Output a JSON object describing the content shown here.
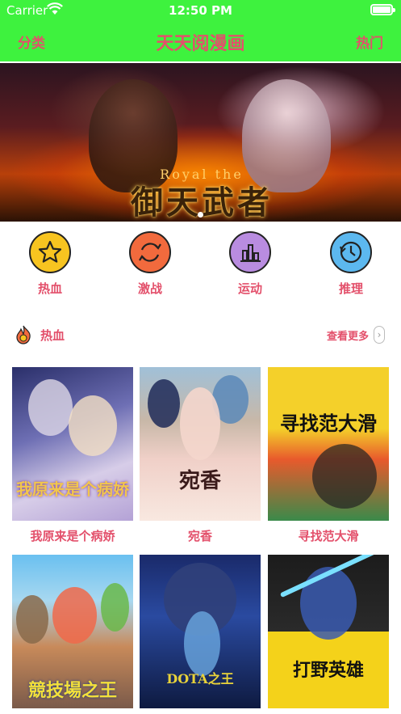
{
  "status": {
    "carrier": "Carrier",
    "time": "12:50 PM"
  },
  "nav": {
    "left": "分类",
    "title": "天天阅漫画",
    "right": "热门"
  },
  "banner": {
    "title_art": "御天武者",
    "title_art_en": "Royal the"
  },
  "categories": [
    {
      "label": "热血",
      "icon": "star-icon",
      "color": "#f7c420"
    },
    {
      "label": "激战",
      "icon": "refresh-icon",
      "color": "#f26a3d"
    },
    {
      "label": "运动",
      "icon": "bar-chart-icon",
      "color": "#b98ce0"
    },
    {
      "label": "推理",
      "icon": "clock-icon",
      "color": "#5cb8ef"
    }
  ],
  "section": {
    "title": "热血",
    "more": "查看更多",
    "arrow": "›"
  },
  "comics": [
    {
      "name": "我原来是个病娇",
      "cover_text": "我原来是个病娇"
    },
    {
      "name": "宛香",
      "cover_text": "宛香"
    },
    {
      "name": "寻找范大滑",
      "cover_text": "寻找范大滑"
    },
    {
      "name": "",
      "cover_text": "競技場之王"
    },
    {
      "name": "",
      "cover_text": "DOTA之王"
    },
    {
      "name": "",
      "cover_text": "打野英雄"
    }
  ],
  "colors": {
    "nav_bg": "#3ef23e",
    "accent": "#e3506b"
  }
}
